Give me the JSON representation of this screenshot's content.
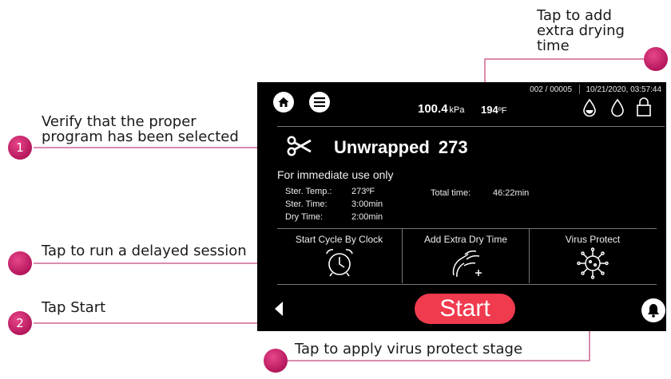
{
  "annotations": {
    "drying_line1": "Tap to add",
    "drying_line2": "extra drying",
    "drying_line3": "time",
    "verify_line1": "Verify that the proper",
    "verify_line2": "program has been selected",
    "delayed": "Tap to run a delayed session",
    "start": "Tap Start",
    "virus": "Tap to apply virus protect stage",
    "badge_1": "1",
    "badge_2": "2"
  },
  "status": {
    "cycle_count": "002 / 00005",
    "datetime": "10/21/2020, 03:57:44",
    "pressure_value": "100.4",
    "pressure_unit": "kPa",
    "temp_value": "194",
    "temp_unit": "ºF"
  },
  "program": {
    "name": "Unwrapped",
    "temp": "273",
    "description": "For immediate use only",
    "ster_temp_label": "Ster. Temp.:",
    "ster_temp_value": "273ºF",
    "ster_time_label": "Ster. Time:",
    "ster_time_value": "3:00min",
    "dry_time_label": "Dry Time:",
    "dry_time_value": "2:00min",
    "total_time_label": "Total time:",
    "total_time_value": "46:22min"
  },
  "tiles": {
    "clock_label": "Start Cycle By Clock",
    "dry_label": "Add Extra Dry Time",
    "virus_label": "Virus Protect"
  },
  "footer": {
    "start_label": "Start"
  },
  "colors": {
    "accent_dot": "#c2185b",
    "start_button": "#f03a4e",
    "screen_bg": "#000000"
  },
  "icons": [
    "home-icon",
    "menu-icon",
    "water-drop-filled-icon",
    "water-drop-icon",
    "lock-icon",
    "scissors-icon",
    "alarm-clock-icon",
    "drying-hand-icon",
    "virus-icon",
    "back-arrow-icon",
    "bell-icon"
  ]
}
